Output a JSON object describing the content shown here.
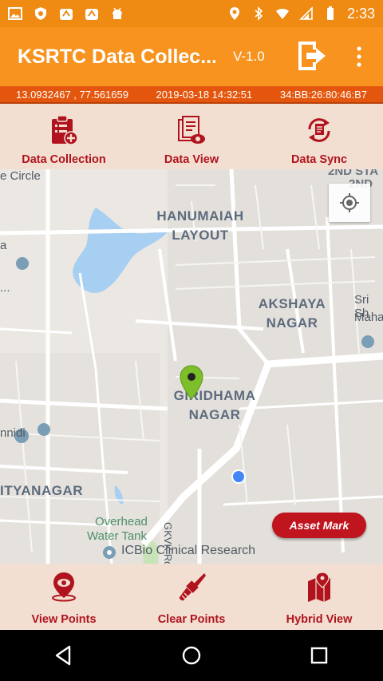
{
  "status_bar": {
    "time": "2:33"
  },
  "app_bar": {
    "title": "KSRTC Data Collec...",
    "version": "V-1.0",
    "exit_icon": "exit-icon",
    "menu_icon": "overflow-menu-icon"
  },
  "info": {
    "coordinates": "13.0932467 , 77.561659",
    "datetime": "2019-03-18 14:32:51",
    "device_id": "34:BB:26:80:46:B7"
  },
  "top_actions": [
    {
      "label": "Data Collection",
      "icon": "clipboard-add-icon"
    },
    {
      "label": "Data View",
      "icon": "document-view-icon"
    },
    {
      "label": "Data Sync",
      "icon": "sync-icon"
    }
  ],
  "map": {
    "labels": {
      "hanumaiah": "HANUMAIAH",
      "layout": "LAYOUT",
      "akshaya": "AKSHAYA",
      "nagar1": "NAGAR",
      "giridhama": "GIRIDHAMA",
      "nagar2": "NAGAR",
      "ityanagar": "ITYANAGAR",
      "circle": "e Circle",
      "nnidi": "nnidi",
      "sri": "Sri Sh",
      "maha": "Maha",
      "stage": "2ND STA",
      "stage2": "2ND",
      "overhead": "Overhead",
      "water_tank": "Water Tank",
      "icbio": "ICBio Clinical Research",
      "gkvk": "GKVK Rd",
      "a": "a",
      "dots": "..."
    },
    "asset_mark_label": "Asset Mark",
    "locate_icon": "my-location-icon",
    "marker_icon": "map-pin-icon"
  },
  "bottom_actions": [
    {
      "label": "View Points",
      "icon": "location-view-icon"
    },
    {
      "label": "Clear Points",
      "icon": "brush-icon"
    },
    {
      "label": "Hybrid View",
      "icon": "map-layers-icon"
    }
  ],
  "colors": {
    "status_bar": "#ef8a12",
    "app_bar": "#f7931e",
    "info_strip": "#e4560d",
    "action_bg": "#f2dfd2",
    "accent_red": "#b0131d"
  }
}
